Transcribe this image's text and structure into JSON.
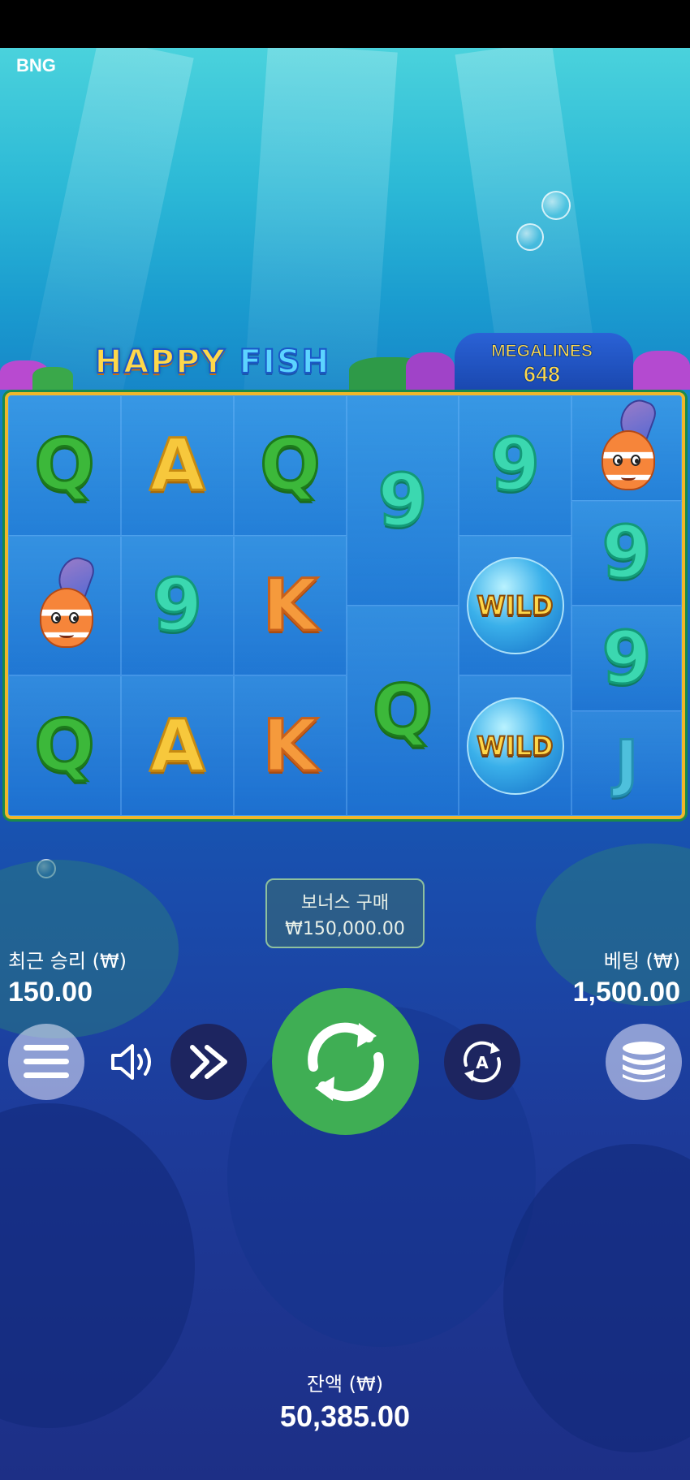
{
  "brand": "BNG",
  "game": {
    "logo_part1": "HAPPY",
    "logo_part2": "FISH",
    "megalines_label": "MEGALINES",
    "megalines_value": "648"
  },
  "reels": [
    [
      "Q",
      "clownfish",
      "Q"
    ],
    [
      "A",
      "9",
      "A"
    ],
    [
      "Q",
      "K",
      "K"
    ],
    [
      "9",
      "Q"
    ],
    [
      "9",
      "WILD",
      "WILD"
    ],
    [
      "clownfish",
      "9",
      "9",
      "J"
    ]
  ],
  "wild_label": "WILD",
  "bonus_buy": {
    "label": "보너스 구매",
    "price": "₩150,000.00"
  },
  "last_win": {
    "label": "최근 승리 (₩)",
    "value": "150.00"
  },
  "bet": {
    "label": "베팅 (₩)",
    "value": "1,500.00"
  },
  "balance": {
    "label": "잔액 (₩)",
    "value": "50,385.00"
  },
  "icons": {
    "menu": "hamburger-menu-icon",
    "sound": "speaker-icon",
    "turbo": "fast-forward-icon",
    "spin": "refresh-arrows-icon",
    "autoplay": "autoplay-icon",
    "bet": "coin-stack-icon"
  },
  "colors": {
    "spin_button": "#3fae54",
    "reel_border": "#f0b72a",
    "dark_button": "#1d2560"
  }
}
